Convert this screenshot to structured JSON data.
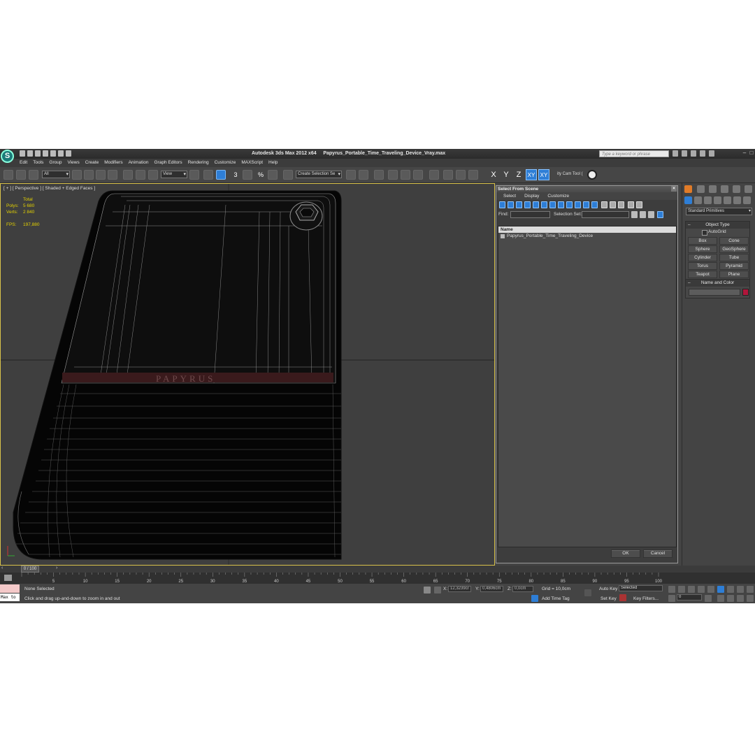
{
  "app": {
    "title_app": "Autodesk 3ds Max  2012 x64",
    "title_file": "Papyrus_Portable_Time_Traveling_Device_Vray.max",
    "search_placeholder": "Type a keyword or phrase",
    "logo_glyph": "S"
  },
  "menu": [
    "Edit",
    "Tools",
    "Group",
    "Views",
    "Create",
    "Modifiers",
    "Animation",
    "Graph Editors",
    "Rendering",
    "Customize",
    "MAXScript",
    "Help"
  ],
  "toolbar": {
    "filter_value": "All",
    "coord_value": "View",
    "selection_set_placeholder": "Create Selection Se",
    "axis_x": "X",
    "axis_y": "Y",
    "axis_z": "Z",
    "axis_xy": "XY",
    "axis_xy2": "XY",
    "cam_tool_label": "ity Cam Tool (",
    "snap_count": "3",
    "snap_percent": "%"
  },
  "viewport": {
    "label": "[ + ] [ Perspective ] [ Shaded + Edged Faces ]",
    "stats_header": "Total",
    "polys_label": "Polys:",
    "polys_value": "5 680",
    "verts_label": "Verts:",
    "verts_value": "2 840",
    "fps_label": "FPS:",
    "fps_value": "197,880",
    "model_text": "PAPYRUS"
  },
  "dialog": {
    "title": "Select From Scene",
    "menu": [
      "Select",
      "Display",
      "Customize"
    ],
    "find_label": "Find:",
    "selection_set_label": "Selection Set:",
    "column_name": "Name",
    "items": [
      "Papyrus_Portable_Time_Traveling_Device"
    ],
    "ok_label": "OK",
    "cancel_label": "Cancel"
  },
  "command_panel": {
    "dropdown": "Standard Primitives",
    "object_type_title": "Object Type",
    "autogrid_label": "AutoGrid",
    "primitives": [
      "Box",
      "Cone",
      "Sphere",
      "GeoSphere",
      "Cylinder",
      "Tube",
      "Torus",
      "Pyramid",
      "Teapot",
      "Plane"
    ],
    "name_color_title": "Name and Color",
    "color": "#b0163b"
  },
  "timeline": {
    "slider_label": "0 / 100",
    "ticks": [
      "0",
      "5",
      "10",
      "15",
      "20",
      "25",
      "30",
      "35",
      "40",
      "45",
      "50",
      "55",
      "60",
      "65",
      "70",
      "75",
      "80",
      "85",
      "90",
      "95",
      "100"
    ]
  },
  "status": {
    "maxscript_text": "Max to",
    "selection_text": "None Selected",
    "prompt_text": "Click and drag up-and-down to zoom in and out",
    "x_label": "X:",
    "x_value": "12,3239cr",
    "y_label": "Y:",
    "y_value": "0,4806cm",
    "z_label": "Z:",
    "z_value": "0,0cm",
    "grid_text": "Grid = 10,0cm",
    "add_time_tag": "Add Time Tag",
    "auto_key": "Auto Key",
    "set_key": "Set Key",
    "key_mode_value": "Selected",
    "key_filters": "Key Filters...",
    "frame_value": "0"
  }
}
